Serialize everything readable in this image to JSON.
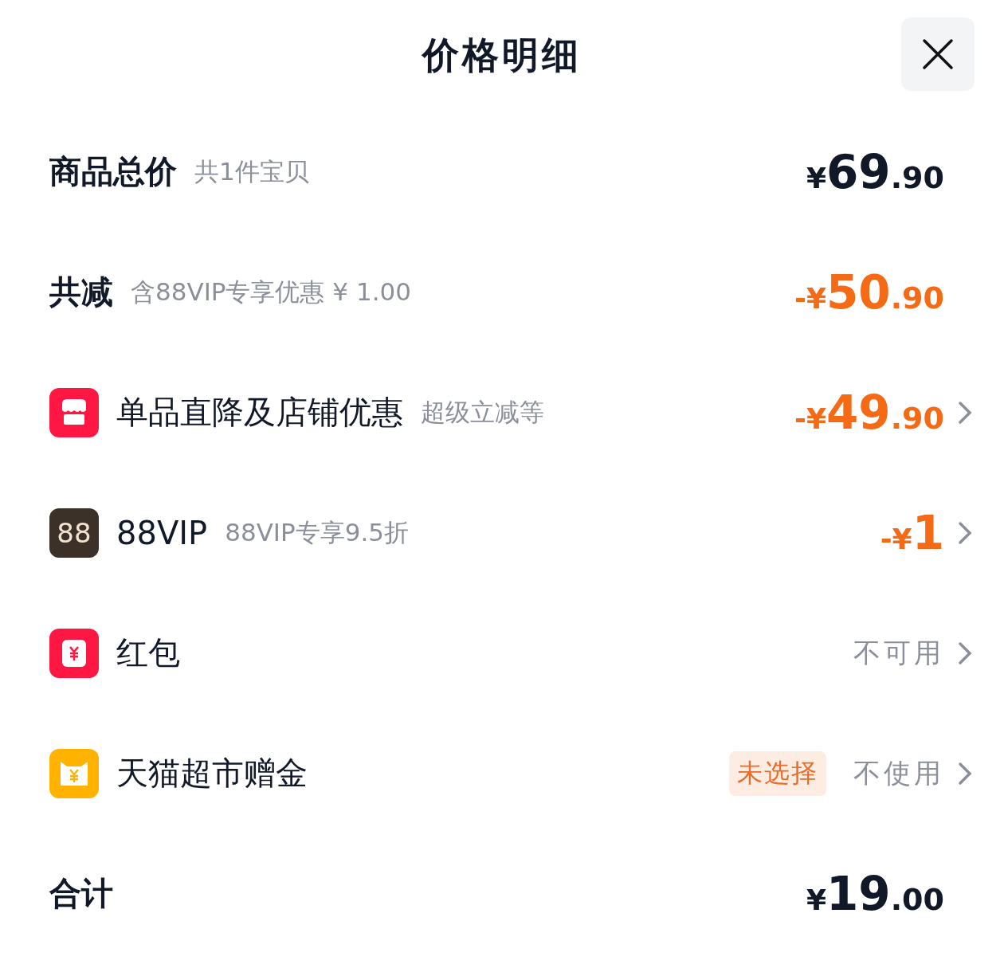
{
  "title": "价格明细",
  "rows": [
    {
      "kind": "summary",
      "label": "商品总价",
      "note": "共1件宝贝",
      "amount": {
        "discount": false,
        "sign": "¥",
        "whole": "69",
        "fraction": ".90"
      },
      "chevron": false
    },
    {
      "kind": "summary",
      "label": "共减",
      "note": "含88VIP专享优惠 ¥ 1.00",
      "amount": {
        "discount": true,
        "sign": "-¥",
        "whole": "50",
        "fraction": ".90"
      },
      "chevron": false
    },
    {
      "kind": "store",
      "label": "单品直降及店铺优惠",
      "note": "超级立减等",
      "amount": {
        "discount": true,
        "sign": "-¥",
        "whole": "49",
        "fraction": ".90"
      },
      "chevron": true
    },
    {
      "kind": "vip",
      "icon_text": "88",
      "label": "88VIP",
      "note": "88VIP专享9.5折",
      "amount": {
        "discount": true,
        "sign": "-¥",
        "whole": "1"
      },
      "chevron": true
    },
    {
      "kind": "envelope",
      "label": "红包",
      "status": "不可用",
      "chevron": true
    },
    {
      "kind": "coupon",
      "label": "天猫超市赠金",
      "tag": "未选择",
      "status": "不使用",
      "chevron": true
    },
    {
      "kind": "summary",
      "label": "合计",
      "amount": {
        "discount": false,
        "sign": "¥",
        "whole": "19",
        "fraction": ".00"
      },
      "chevron": false
    }
  ]
}
